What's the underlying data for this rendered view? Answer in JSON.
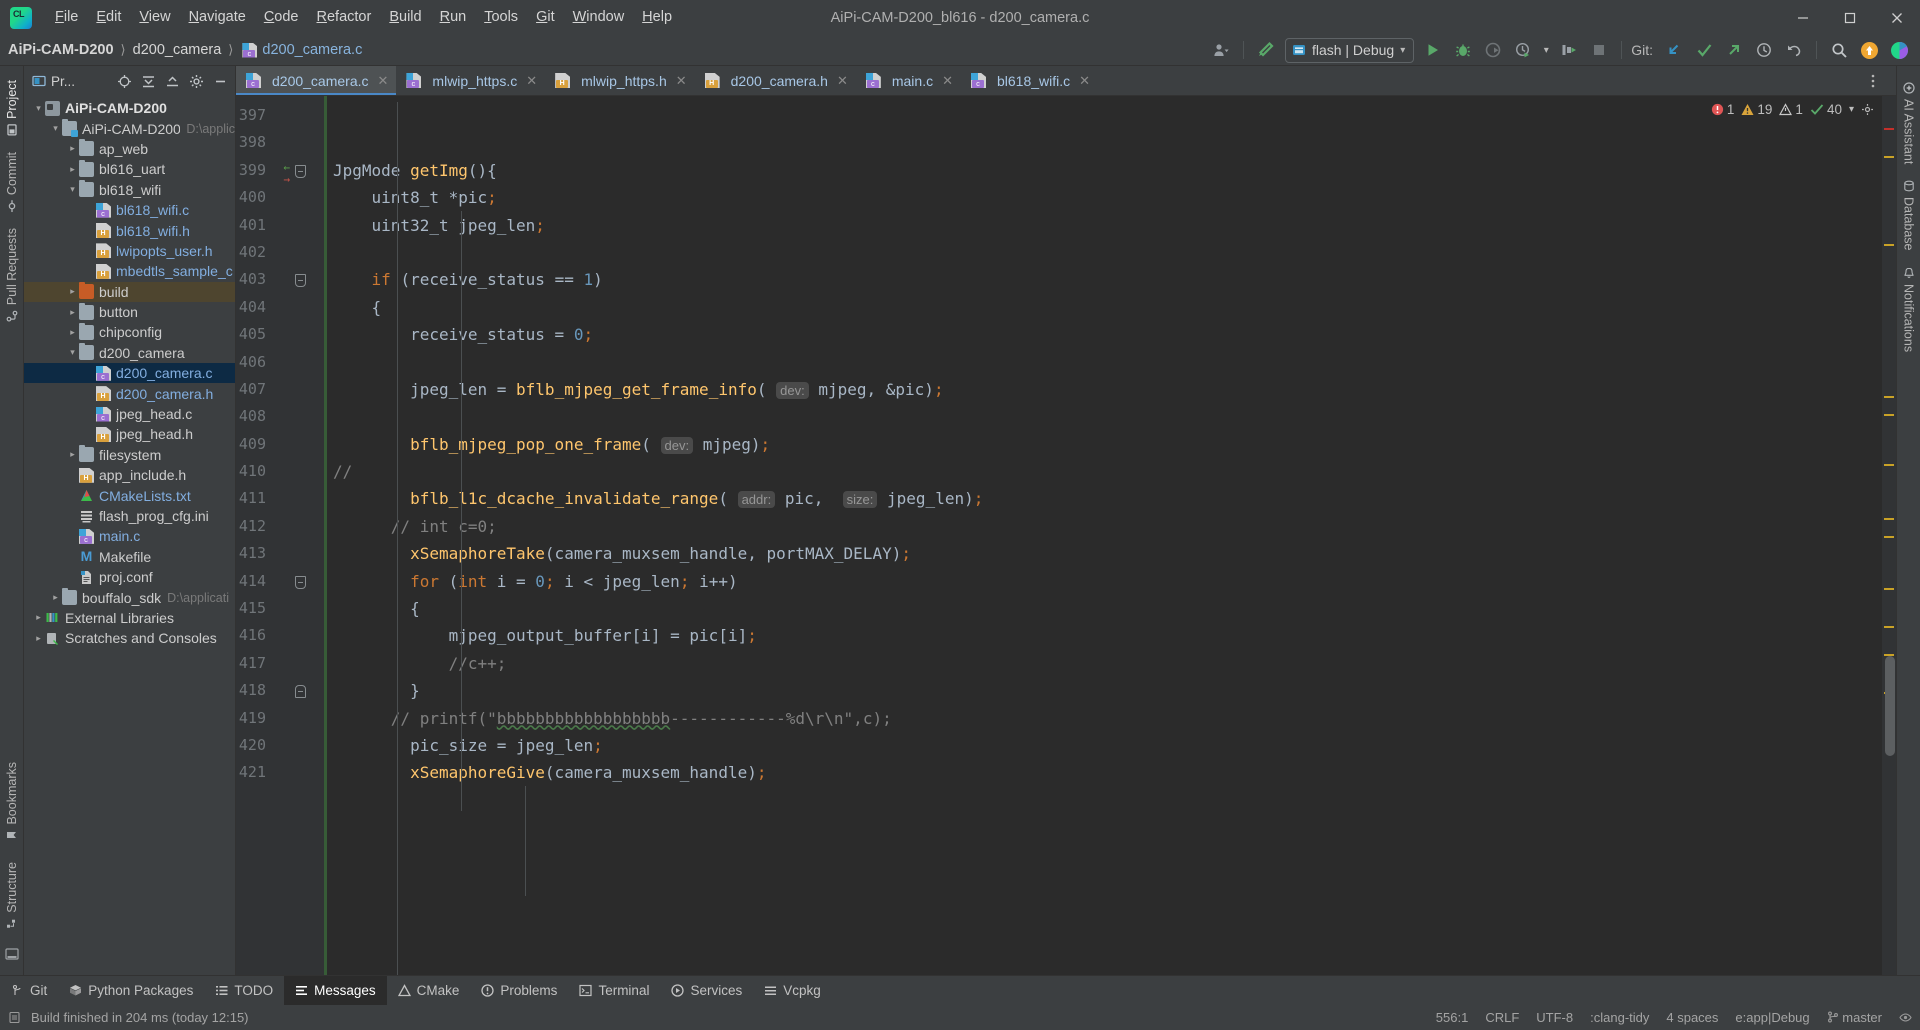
{
  "window": {
    "title": "AiPi-CAM-D200_bl616 - d200_camera.c",
    "logo_icon": "clion-logo-icon",
    "controls": [
      {
        "name": "minimize-button",
        "glyph": "—"
      },
      {
        "name": "maximize-button",
        "glyph": "❐"
      },
      {
        "name": "close-button",
        "glyph": "✕"
      }
    ]
  },
  "menu": [
    {
      "label": "File",
      "mnemonic": "F"
    },
    {
      "label": "Edit",
      "mnemonic": "E"
    },
    {
      "label": "View",
      "mnemonic": "V"
    },
    {
      "label": "Navigate",
      "mnemonic": "N"
    },
    {
      "label": "Code",
      "mnemonic": "C"
    },
    {
      "label": "Refactor",
      "mnemonic": "R"
    },
    {
      "label": "Build",
      "mnemonic": "B"
    },
    {
      "label": "Run",
      "mnemonic": "R"
    },
    {
      "label": "Tools",
      "mnemonic": "T"
    },
    {
      "label": "Git",
      "mnemonic": "G"
    },
    {
      "label": "Window",
      "mnemonic": "W"
    },
    {
      "label": "Help",
      "mnemonic": "H"
    }
  ],
  "breadcrumb": [
    {
      "label": "AiPi-CAM-D200",
      "kind": "project"
    },
    {
      "label": "d200_camera",
      "kind": "folder"
    },
    {
      "label": "d200_camera.c",
      "kind": "file"
    }
  ],
  "toolbar": {
    "user_icon": "user-account-icon",
    "build_icon": "hammer-build-icon",
    "run_config": {
      "label": "flash | Debug",
      "icon": "run-config-icon",
      "chevron": "▾"
    },
    "run_icon": "run-play-icon",
    "debug_icon": "debug-bug-icon",
    "run_coverage_icon": "run-with-coverage-icon",
    "profiler_icon": "profiler-clock-icon",
    "profiler_chevron": "▾",
    "attach_icon": "attach-to-process-icon",
    "stop_icon": "stop-square-icon",
    "git_label": "Git:",
    "git_update_icon": "git-update-project-icon",
    "git_commit_icon": "git-commit-checkmark-icon",
    "git_push_icon": "git-push-arrow-icon",
    "git_history_icon": "git-history-clock-icon",
    "git_rollback_icon": "git-rollback-undo-icon",
    "search_icon": "search-everywhere-icon",
    "updates_icon": "ide-update-available-icon",
    "ai_icon": "ai-assistant-icon"
  },
  "left_strip": {
    "tabs": [
      {
        "label": "Project",
        "name": "tool-window-project",
        "icon": "project-icon",
        "selected": true
      },
      {
        "label": "Commit",
        "name": "tool-window-commit",
        "icon": "commit-icon",
        "selected": false
      },
      {
        "label": "Pull Requests",
        "name": "tool-window-pull-requests",
        "icon": "pull-requests-icon",
        "selected": false
      }
    ],
    "bottom_tabs": [
      {
        "label": "Bookmarks",
        "name": "tool-window-bookmarks",
        "icon": "bookmark-icon"
      },
      {
        "label": "Structure",
        "name": "tool-window-structure",
        "icon": "structure-icon"
      }
    ],
    "bottom_icon": "terminal-bottom-icon"
  },
  "right_strip": {
    "tabs": [
      {
        "label": "AI Assistant",
        "name": "tool-window-ai-assistant",
        "icon": "ai-assistant-icon"
      },
      {
        "label": "Database",
        "name": "tool-window-database",
        "icon": "database-icon"
      },
      {
        "label": "Notifications",
        "name": "tool-window-notifications",
        "icon": "notifications-bell-icon"
      }
    ]
  },
  "project_panel": {
    "title": "Pr...",
    "header_buttons": [
      {
        "name": "select-opened-file-button",
        "icon": "crosshair-icon"
      },
      {
        "name": "expand-all-button",
        "icon": "expand-all-icon"
      },
      {
        "name": "collapse-all-button",
        "icon": "collapse-all-icon"
      },
      {
        "name": "project-settings-button",
        "icon": "gear-icon"
      },
      {
        "name": "hide-panel-button",
        "icon": "minus-icon"
      }
    ],
    "tree": [
      {
        "label": "AiPi-CAM-D200",
        "depth": 0,
        "arrow": "down",
        "icon": "project-root-icon",
        "style": "bold",
        "hint": ""
      },
      {
        "label": "AiPi-CAM-D200",
        "depth": 1,
        "arrow": "down",
        "icon": "source-folder-icon",
        "style": "plain",
        "hint": "D:\\applic"
      },
      {
        "label": "ap_web",
        "depth": 2,
        "arrow": "right",
        "icon": "folder-icon",
        "style": "plain",
        "hint": ""
      },
      {
        "label": "bl616_uart",
        "depth": 2,
        "arrow": "right",
        "icon": "folder-icon",
        "style": "plain",
        "hint": ""
      },
      {
        "label": "bl618_wifi",
        "depth": 2,
        "arrow": "down",
        "icon": "folder-icon",
        "style": "plain",
        "hint": ""
      },
      {
        "label": "bl618_wifi.c",
        "depth": 3,
        "arrow": "none",
        "icon": "c-file-icon",
        "style": "blue",
        "hint": ""
      },
      {
        "label": "bl618_wifi.h",
        "depth": 3,
        "arrow": "none",
        "icon": "h-file-icon",
        "style": "blue",
        "hint": ""
      },
      {
        "label": "lwipopts_user.h",
        "depth": 3,
        "arrow": "none",
        "icon": "h-file-icon",
        "style": "blue",
        "hint": ""
      },
      {
        "label": "mbedtls_sample_c",
        "depth": 3,
        "arrow": "none",
        "icon": "h-file-icon",
        "style": "blue",
        "hint": ""
      },
      {
        "label": "build",
        "depth": 2,
        "arrow": "right",
        "icon": "build-folder-icon",
        "style": "plain",
        "hint": "",
        "selected": "brown"
      },
      {
        "label": "button",
        "depth": 2,
        "arrow": "right",
        "icon": "folder-icon",
        "style": "plain",
        "hint": ""
      },
      {
        "label": "chipconfig",
        "depth": 2,
        "arrow": "right",
        "icon": "folder-icon",
        "style": "plain",
        "hint": ""
      },
      {
        "label": "d200_camera",
        "depth": 2,
        "arrow": "down",
        "icon": "folder-icon",
        "style": "plain",
        "hint": ""
      },
      {
        "label": "d200_camera.c",
        "depth": 3,
        "arrow": "none",
        "icon": "c-file-icon",
        "style": "blue",
        "hint": "",
        "selected": "blue"
      },
      {
        "label": "d200_camera.h",
        "depth": 3,
        "arrow": "none",
        "icon": "h-file-icon",
        "style": "blue",
        "hint": ""
      },
      {
        "label": "jpeg_head.c",
        "depth": 3,
        "arrow": "none",
        "icon": "c-file-icon",
        "style": "plain",
        "hint": ""
      },
      {
        "label": "jpeg_head.h",
        "depth": 3,
        "arrow": "none",
        "icon": "h-file-icon",
        "style": "plain",
        "hint": ""
      },
      {
        "label": "filesystem",
        "depth": 2,
        "arrow": "right",
        "icon": "folder-icon",
        "style": "plain",
        "hint": ""
      },
      {
        "label": "app_include.h",
        "depth": 2,
        "arrow": "none",
        "icon": "h-file-icon",
        "style": "plain",
        "hint": ""
      },
      {
        "label": "CMakeLists.txt",
        "depth": 2,
        "arrow": "none",
        "icon": "cmake-file-icon",
        "style": "blue",
        "hint": ""
      },
      {
        "label": "flash_prog_cfg.ini",
        "depth": 2,
        "arrow": "none",
        "icon": "ini-file-icon",
        "style": "plain",
        "hint": ""
      },
      {
        "label": "main.c",
        "depth": 2,
        "arrow": "none",
        "icon": "c-file-icon",
        "style": "blue",
        "hint": ""
      },
      {
        "label": "Makefile",
        "depth": 2,
        "arrow": "none",
        "icon": "makefile-icon",
        "style": "plain",
        "hint": ""
      },
      {
        "label": "proj.conf",
        "depth": 2,
        "arrow": "none",
        "icon": "conf-file-icon",
        "style": "plain",
        "hint": ""
      },
      {
        "label": "bouffalo_sdk",
        "depth": 1,
        "arrow": "right",
        "icon": "folder-icon",
        "style": "plain",
        "hint": "D:\\applicati"
      },
      {
        "label": "External Libraries",
        "depth": 0,
        "arrow": "right",
        "icon": "external-libraries-icon",
        "style": "plain",
        "hint": ""
      },
      {
        "label": "Scratches and Consoles",
        "depth": 0,
        "arrow": "right",
        "icon": "scratches-icon",
        "style": "plain",
        "hint": ""
      }
    ]
  },
  "editor_tabs": [
    {
      "label": "d200_camera.c",
      "icon": "c-file-icon",
      "active": true
    },
    {
      "label": "mlwip_https.c",
      "icon": "c-file-icon",
      "active": false
    },
    {
      "label": "mlwip_https.h",
      "icon": "h-file-icon",
      "active": false
    },
    {
      "label": "d200_camera.h",
      "icon": "h-file-icon",
      "active": false
    },
    {
      "label": "main.c",
      "icon": "c-file-icon",
      "active": false
    },
    {
      "label": "bl618_wifi.c",
      "icon": "c-file-icon",
      "active": false
    }
  ],
  "editor_tabs_more_icon": "more-options-icon",
  "inspection": {
    "error_icon": "error-circle-icon",
    "error_count": "1",
    "warning_icon": "warning-triangle-icon",
    "warning_count": "19",
    "weak_warning_icon": "weak-warning-icon",
    "weak_warning_count": "1",
    "typo_icon": "typo-check-icon",
    "typo_count": "40",
    "chevron_icon": "chevron-down-icon",
    "settings_icon": "inspections-settings-icon"
  },
  "code": {
    "first_line_number": 397,
    "lines": [
      {
        "n": 397,
        "text": "",
        "fold": "",
        "marker": ""
      },
      {
        "n": 398,
        "text": "",
        "fold": "",
        "marker": ""
      },
      {
        "n": 399,
        "text": "JpgMode getImg(){",
        "fold": "open",
        "marker": "override"
      },
      {
        "n": 400,
        "text": "    uint8_t *pic;",
        "fold": "",
        "marker": ""
      },
      {
        "n": 401,
        "text": "    uint32_t jpeg_len;",
        "fold": "",
        "marker": ""
      },
      {
        "n": 402,
        "text": "",
        "fold": "",
        "marker": ""
      },
      {
        "n": 403,
        "text": "    if (receive_status == 1)",
        "fold": "open",
        "marker": ""
      },
      {
        "n": 404,
        "text": "    {",
        "fold": "",
        "marker": ""
      },
      {
        "n": 405,
        "text": "        receive_status = 0;",
        "fold": "",
        "marker": ""
      },
      {
        "n": 406,
        "text": "",
        "fold": "",
        "marker": ""
      },
      {
        "n": 407,
        "text": "        jpeg_len = bflb_mjpeg_get_frame_info( dev: mjpeg, &pic);",
        "fold": "",
        "marker": ""
      },
      {
        "n": 408,
        "text": "",
        "fold": "",
        "marker": ""
      },
      {
        "n": 409,
        "text": "        bflb_mjpeg_pop_one_frame( dev: mjpeg);",
        "fold": "",
        "marker": ""
      },
      {
        "n": 410,
        "text": "//",
        "fold": "",
        "marker": ""
      },
      {
        "n": 411,
        "text": "        bflb_l1c_dcache_invalidate_range( addr: pic,  size: jpeg_len);",
        "fold": "",
        "marker": ""
      },
      {
        "n": 412,
        "text": "      // int c=0;",
        "fold": "",
        "marker": ""
      },
      {
        "n": 413,
        "text": "        xSemaphoreTake(camera_muxsem_handle, portMAX_DELAY);",
        "fold": "",
        "marker": ""
      },
      {
        "n": 414,
        "text": "        for (int i = 0; i < jpeg_len; i++)",
        "fold": "open",
        "marker": ""
      },
      {
        "n": 415,
        "text": "        {",
        "fold": "",
        "marker": ""
      },
      {
        "n": 416,
        "text": "            mjpeg_output_buffer[i] = pic[i];",
        "fold": "",
        "marker": ""
      },
      {
        "n": 417,
        "text": "            //c++;",
        "fold": "",
        "marker": ""
      },
      {
        "n": 418,
        "text": "        }",
        "fold": "close",
        "marker": ""
      },
      {
        "n": 419,
        "text": "      // printf(\"bbbbbbbbbbbbbbbbbb------------%d\\r\\n\",c);",
        "fold": "",
        "marker": ""
      },
      {
        "n": 420,
        "text": "        pic_size = jpeg_len;",
        "fold": "",
        "marker": ""
      },
      {
        "n": 421,
        "text": "        xSemaphoreGive(camera_muxsem_handle);",
        "fold": "",
        "marker": ""
      }
    ]
  },
  "bottom_tabs": [
    {
      "label": "Git",
      "icon": "git-branch-icon",
      "active": false
    },
    {
      "label": "Python Packages",
      "icon": "python-packages-icon",
      "active": false
    },
    {
      "label": "TODO",
      "icon": "todo-list-icon",
      "active": false
    },
    {
      "label": "Messages",
      "icon": "messages-icon",
      "active": true
    },
    {
      "label": "CMake",
      "icon": "cmake-icon",
      "active": false
    },
    {
      "label": "Problems",
      "icon": "problems-icon",
      "active": false
    },
    {
      "label": "Terminal",
      "icon": "terminal-icon",
      "active": false
    },
    {
      "label": "Services",
      "icon": "services-icon",
      "active": false
    },
    {
      "label": "Vcpkg",
      "icon": "vcpkg-icon",
      "active": false
    }
  ],
  "status_bar": {
    "build_message": "Build finished in 204 ms (today 12:15)",
    "caret_position": "556:1",
    "line_separator": "CRLF",
    "encoding": "UTF-8",
    "clang_tidy": ":clang-tidy",
    "indent": "4 spaces",
    "context": "e:app|Debug",
    "branch": "master",
    "branch_icon": "git-branch-icon",
    "lock_icon": "read-only-lock-icon",
    "inspections_icon": "inspections-eye-icon"
  },
  "colors": {
    "accent_blue": "#4a88c7",
    "editor_bg": "#2b2b2b",
    "panel_bg": "#3c3f41",
    "gutter_bg": "#313335",
    "keyword": "#cc7832",
    "number": "#6897bb",
    "function": "#ffc66d",
    "string": "#6a8759",
    "comment": "#808080",
    "text": "#a9b7c6",
    "change_bar_green": "#375c37",
    "selection_blue": "#0d2a44",
    "error_red": "#c4302b",
    "warning_yellow": "#c9a227"
  }
}
